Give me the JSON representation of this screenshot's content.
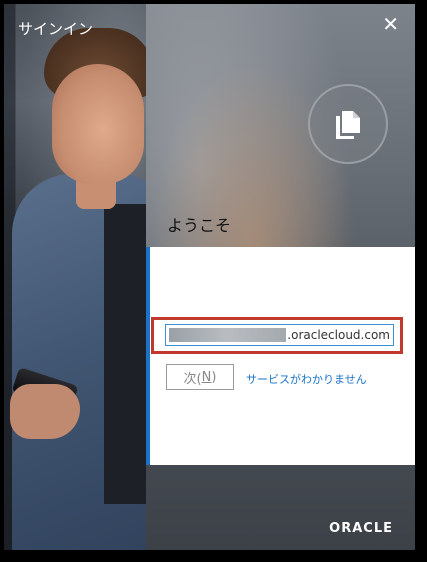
{
  "window": {
    "title": "サインイン",
    "close_icon": "close-icon"
  },
  "header": {
    "logo_icon": "document-copy-icon",
    "welcome": "ようこそ"
  },
  "form": {
    "service_domain_suffix": ".oraclecloud.com",
    "next_label_prefix": "次(",
    "next_label_accel": "N",
    "next_label_suffix": ")",
    "unknown_service_link": "サービスがわかりません"
  },
  "footer": {
    "brand": "ORACLE"
  },
  "colors": {
    "accent": "#1a73c8",
    "highlight_border": "#c0392b"
  }
}
